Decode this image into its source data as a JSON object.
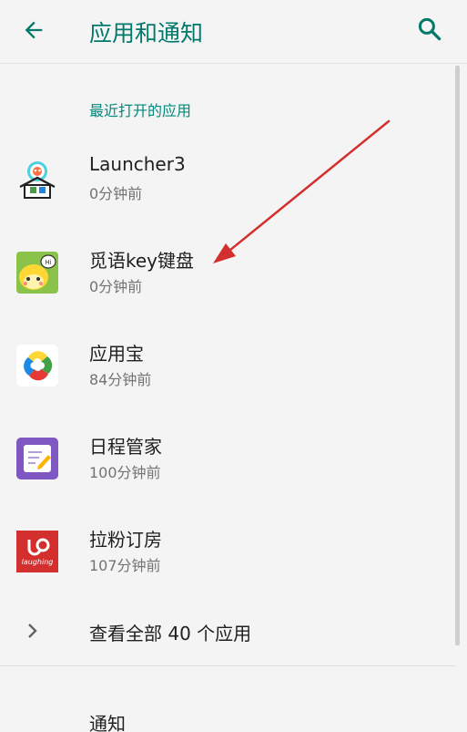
{
  "header": {
    "title": "应用和通知",
    "back_icon": "arrow-left-icon",
    "search_icon": "search-icon"
  },
  "recent": {
    "section_title": "最近打开的应用",
    "apps": [
      {
        "name": "Launcher3",
        "time": "0分钟前",
        "icon": "launcher3-icon"
      },
      {
        "name": "觅语key键盘",
        "time": "0分钟前",
        "icon": "miyu-keyboard-icon"
      },
      {
        "name": "应用宝",
        "time": "84分钟前",
        "icon": "yingyongbao-icon"
      },
      {
        "name": "日程管家",
        "time": "100分钟前",
        "icon": "schedule-manager-icon"
      },
      {
        "name": "拉粉订房",
        "time": "107分钟前",
        "icon": "lafen-booking-icon"
      }
    ]
  },
  "see_all": {
    "label": "查看全部 40 个应用",
    "icon": "chevron-right-icon"
  },
  "notifications": {
    "label": "通知"
  },
  "annotation": {
    "color": "#d32f2f",
    "icon": "red-arrow-annotation"
  },
  "colors": {
    "accent": "#00796b",
    "background": "#f4f4f4"
  }
}
